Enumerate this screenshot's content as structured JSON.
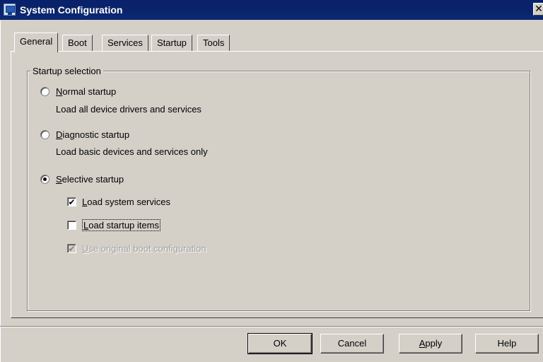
{
  "window": {
    "title": "System Configuration",
    "close_glyph": "✕"
  },
  "tabs": [
    {
      "label": "General",
      "active": true
    },
    {
      "label": "Boot",
      "active": false
    },
    {
      "label": "Services",
      "active": false
    },
    {
      "label": "Startup",
      "active": false
    },
    {
      "label": "Tools",
      "active": false
    }
  ],
  "startup_selection": {
    "legend": "Startup selection",
    "normal": {
      "mnemonic": "N",
      "rest": "ormal startup",
      "description": "Load all device drivers and services",
      "checked": false
    },
    "diagnostic": {
      "mnemonic": "D",
      "rest": "iagnostic startup",
      "description": "Load basic devices and services only",
      "checked": false
    },
    "selective": {
      "mnemonic": "S",
      "rest": "elective startup",
      "checked": true
    },
    "options": {
      "load_system_services": {
        "mnemonic": "L",
        "rest": "oad system services",
        "checked": true,
        "enabled": true
      },
      "load_startup_items": {
        "mnemonic": "L",
        "rest": "oad startup items",
        "checked": false,
        "enabled": true,
        "focused": true
      },
      "use_original_boot": {
        "mnemonic": "U",
        "rest": "se original boot configuration",
        "checked": true,
        "enabled": false
      }
    },
    "check_glyph": "✔"
  },
  "buttons": {
    "ok": "OK",
    "cancel": "Cancel",
    "apply_mnemonic": "A",
    "apply_rest": "pply",
    "help": "Help"
  }
}
